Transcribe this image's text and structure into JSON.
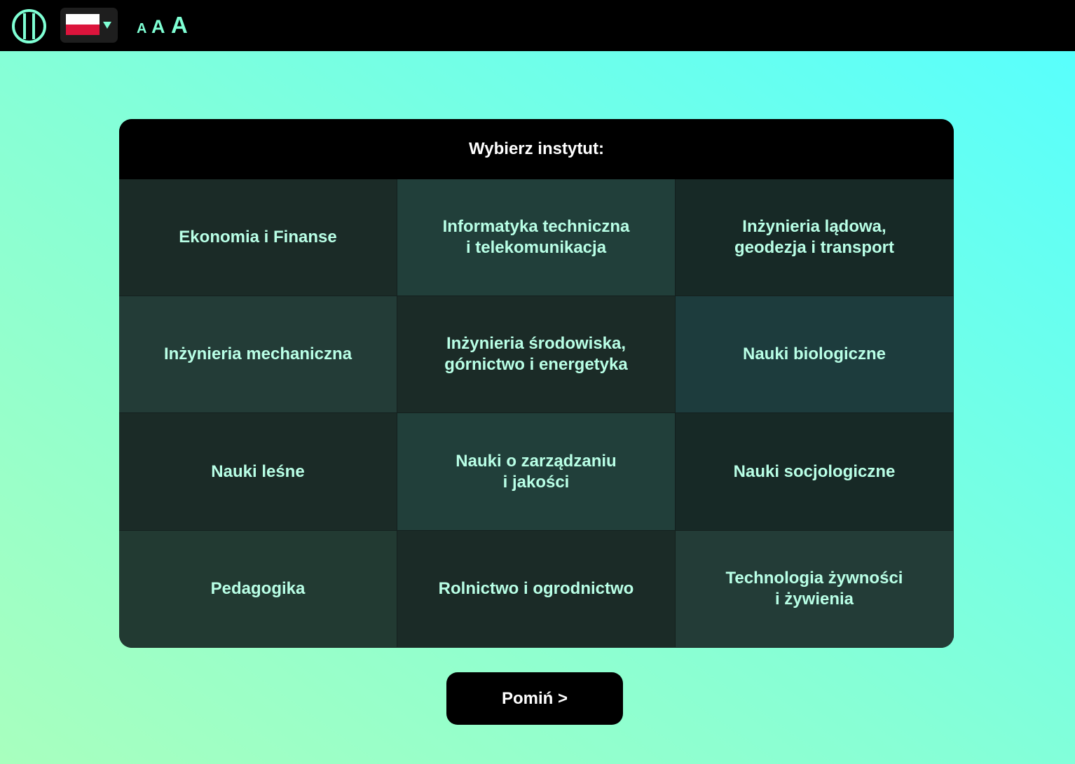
{
  "topbar": {
    "logo_icon": "accessibility-contrast-icon",
    "language": {
      "selected": "Polski",
      "flag_icon": "poland-flag-icon",
      "colors": {
        "white": "#ffffff",
        "red": "#dc143c"
      }
    },
    "font_size_options": [
      "A",
      "A",
      "A"
    ]
  },
  "panel": {
    "title": "Wybierz instytut:",
    "institutes": [
      {
        "label": "Ekonomia i Finanse"
      },
      {
        "label": "Informatyka techniczna\ni telekomunikacja"
      },
      {
        "label": "Inżynieria lądowa,\ngeodezja i transport"
      },
      {
        "label": "Inżynieria mechaniczna"
      },
      {
        "label": "Inżynieria środowiska,\ngórnictwo i energetyka"
      },
      {
        "label": "Nauki biologiczne"
      },
      {
        "label": "Nauki leśne"
      },
      {
        "label": "Nauki o zarządzaniu\ni jakości"
      },
      {
        "label": "Nauki socjologiczne"
      },
      {
        "label": "Pedagogika"
      },
      {
        "label": "Rolnictwo i ogrodnictwo"
      },
      {
        "label": "Technologia żywności\ni żywienia"
      }
    ]
  },
  "skip_button": {
    "label": "Pomiń >"
  },
  "colors": {
    "accent": "#7fffd4",
    "background_gradient": [
      "#a8ffbe",
      "#55ffff"
    ],
    "cell_text": "#b9ffe6"
  }
}
